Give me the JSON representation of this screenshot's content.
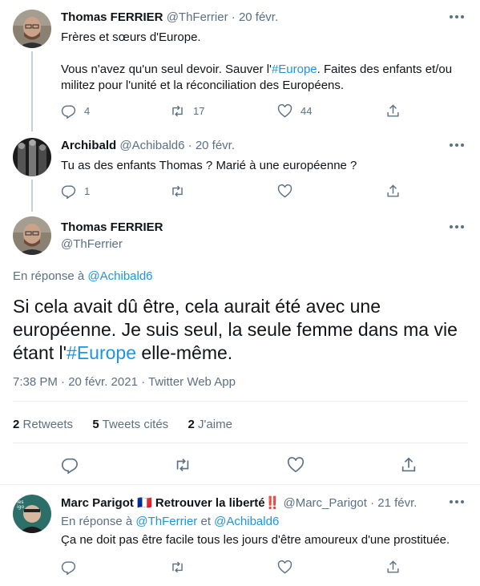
{
  "tweet1": {
    "display_name": "Thomas FERRIER",
    "handle": "@ThFerrier",
    "date": "20 févr.",
    "line1": "Frères et sœurs d'Europe.",
    "line2_before": "Vous n'avez qu'un seul devoir. Sauver l'",
    "hashtag": "#Europe",
    "line2_after": ". Faites des enfants et/ou",
    "line3": "militez pour l'unité et la réconciliation des Européens.",
    "replies": "4",
    "retweets": "17",
    "likes": "44"
  },
  "tweet2": {
    "display_name": "Archibald",
    "handle": "@Achibald6",
    "date": "20 févr.",
    "text": "Tu as des enfants Thomas ? Marié à une européenne ?",
    "replies": "1"
  },
  "main": {
    "display_name": "Thomas FERRIER",
    "handle": "@ThFerrier",
    "reply_prefix": "En réponse à",
    "reply_to": "@Achibald6",
    "text_before": "Si cela avait dû être, cela aurait été avec une européenne. Je suis seul, la seule femme dans ma vie étant l'",
    "hashtag": "#Europe",
    "text_after": " elle-même.",
    "timestamp": "7:38 PM · 20 févr. 2021 · Twitter Web App",
    "retweets_count": "2",
    "retweets_label": "Retweets",
    "quotes_count": "5",
    "quotes_label": "Tweets cités",
    "likes_count": "2",
    "likes_label": "J'aime"
  },
  "tweet4": {
    "display_name_1": "Marc Parigot",
    "flag": "🇫🇷",
    "display_name_2": "Retrouver la liberté",
    "emoji": "‼️",
    "handle": "@Marc_Parigot",
    "date": "21 févr.",
    "reply_prefix": "En réponse à",
    "reply_to_1": "@ThFerrier",
    "reply_and": "et",
    "reply_to_2": "@Achibald6",
    "text": "Ça ne doit pas être facile tous les jours d'être amoureux d'une prostituée.",
    "avatar_text": "les\nigo"
  },
  "colors": {
    "link": "#1b95e0",
    "muted": "#5b7083",
    "divider": "#ebeef0",
    "thread": "#c4cfd6"
  },
  "icons": [
    "reply-icon",
    "retweet-icon",
    "like-icon",
    "share-icon",
    "more-icon"
  ]
}
